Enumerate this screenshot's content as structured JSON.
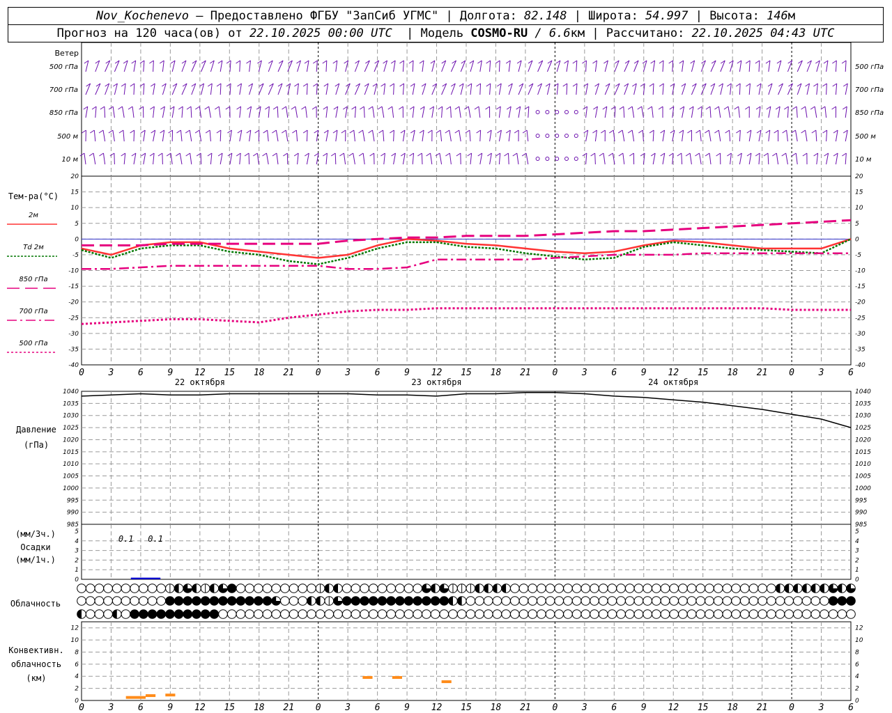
{
  "header": {
    "line1": {
      "station": "Nov_Kochenevo",
      "provider": " – Предоставлено ФГБУ \"ЗапСиб УГМС\" | Долгота: ",
      "lon": "82.148",
      "lat_label": " | Широта: ",
      "lat": "54.997",
      "alt_label": " | Высота: ",
      "alt": "146",
      "alt_unit": "м"
    },
    "line2": {
      "prefix": "Прогноз на 120 часа(ов) от ",
      "start": "22.10.2025 00:00 UTC",
      "model_label": "  | Модель ",
      "model": "COSMO-RU",
      "res": " / 6.6",
      "res_unit": "км",
      "calc_label": " | Рассчитано: ",
      "calc": "22.10.2025 04:43 UTC"
    }
  },
  "colors": {
    "wind": "#6a0dad",
    "t2m": "#ff3333",
    "td2m": "#007700",
    "t850": "#e6007e",
    "t700": "#e6007e",
    "t500": "#e6007e",
    "pressure": "#000000",
    "precip": "#0000cc",
    "convective": "#ff8c1a",
    "grid": "#9a9a9a"
  },
  "time_axis": {
    "hour_labels": [
      "0",
      "3",
      "6",
      "9",
      "12",
      "15",
      "18",
      "21",
      "0",
      "3",
      "6",
      "9",
      "12",
      "15",
      "18",
      "21",
      "0",
      "3",
      "6",
      "9",
      "12",
      "15",
      "18",
      "21",
      "0",
      "3",
      "6"
    ],
    "day_labels": [
      "22 октября",
      "23 октября",
      "24 октября"
    ]
  },
  "wind_panel": {
    "title": "Ветер",
    "levels": [
      "500 гПа",
      "700 гПа",
      "850 гПа",
      "500 м",
      "10 м"
    ]
  },
  "chart_data": [
    {
      "type": "line",
      "title": "Тем-ра(°C)",
      "ylim": [
        -40,
        20
      ],
      "yticks": [
        "20",
        "15",
        "10",
        "5",
        "0",
        "-5",
        "-10",
        "-15",
        "-20",
        "-25",
        "-30",
        "-35",
        "-40"
      ],
      "x_hours": [
        0,
        3,
        6,
        9,
        12,
        15,
        18,
        21,
        24,
        27,
        30,
        33,
        36,
        39,
        42,
        45,
        48,
        51,
        54,
        57,
        60,
        63,
        66,
        69,
        72,
        75,
        78
      ],
      "series": [
        {
          "name": "2м",
          "values": [
            -3,
            -5,
            -2,
            -1,
            -1,
            -3,
            -4,
            -5,
            -6,
            -5,
            -2,
            0,
            -0.5,
            -1.5,
            -2,
            -3,
            -4,
            -4.5,
            -4,
            -2,
            -0.5,
            -1,
            -2,
            -3,
            -3,
            -3,
            0
          ]
        },
        {
          "name": "Td 2м",
          "values": [
            -3.5,
            -6,
            -3,
            -2,
            -2,
            -4,
            -5,
            -7,
            -8,
            -6,
            -3,
            -1,
            -1,
            -2.5,
            -3,
            -4.5,
            -5.5,
            -6.5,
            -6,
            -2.5,
            -1,
            -2,
            -3,
            -3.5,
            -4,
            -4.5,
            0
          ]
        },
        {
          "name": "850 гПа",
          "values": [
            -2,
            -2,
            -2,
            -1.5,
            -1.5,
            -1.5,
            -1.5,
            -1.5,
            -1.5,
            -0.5,
            0,
            0.5,
            0.5,
            1,
            1,
            1,
            1.5,
            2,
            2.5,
            2.5,
            3,
            3.5,
            4,
            4.5,
            5,
            5.5,
            6
          ]
        },
        {
          "name": "700 гПа",
          "values": [
            -9.5,
            -9.5,
            -9,
            -8.5,
            -8.5,
            -8.5,
            -8.5,
            -8.5,
            -8.5,
            -9.5,
            -9.5,
            -9,
            -6.5,
            -6.5,
            -6.5,
            -6.5,
            -6,
            -5.5,
            -5,
            -5,
            -5,
            -4.5,
            -4.5,
            -4.5,
            -4.5,
            -4.5,
            -4.5
          ]
        },
        {
          "name": "500 гПа",
          "values": [
            -27,
            -26.5,
            -26,
            -25.5,
            -25.5,
            -26,
            -26.5,
            -25,
            -24,
            -23,
            -22.5,
            -22.5,
            -22,
            -22,
            -22,
            -22,
            -22,
            -22,
            -22,
            -22,
            -22,
            -22,
            -22,
            -22,
            -22.5,
            -22.5,
            -22.5
          ]
        }
      ]
    },
    {
      "type": "line",
      "title": "Давление",
      "ylabel": "(гПа)",
      "ylim": [
        985,
        1040
      ],
      "yticks": [
        "1040",
        "1035",
        "1030",
        "1025",
        "1020",
        "1015",
        "1010",
        "1005",
        "1000",
        "995",
        "990",
        "985"
      ],
      "x_hours": [
        0,
        3,
        6,
        9,
        12,
        15,
        18,
        21,
        24,
        27,
        30,
        33,
        36,
        39,
        42,
        45,
        48,
        51,
        54,
        57,
        60,
        63,
        66,
        69,
        72,
        75,
        78
      ],
      "series": [
        {
          "name": "Давление",
          "values": [
            1038,
            1038.5,
            1039,
            1038.5,
            1038.5,
            1039,
            1039,
            1039,
            1039,
            1039,
            1038.5,
            1038.5,
            1038,
            1039,
            1039,
            1039.5,
            1039.5,
            1039,
            1038,
            1037.5,
            1036.5,
            1035.5,
            1034,
            1032.5,
            1030.5,
            1028.5,
            1025
          ]
        }
      ]
    },
    {
      "type": "bar",
      "title": "Осадки",
      "ylabel_top": "(мм/3ч.)",
      "ylabel_bottom": "(мм/1ч.)",
      "ylim": [
        0,
        5
      ],
      "yticks": [
        "5",
        "4",
        "3",
        "2",
        "1",
        "0"
      ],
      "annotations": [
        {
          "hour": 4.5,
          "text": "0.1"
        },
        {
          "hour": 7.5,
          "text": "0.1"
        }
      ],
      "bars": [
        {
          "from": 5,
          "to": 8,
          "value": 0.1
        }
      ]
    },
    {
      "type": "bar",
      "title": "Конвективн.",
      "ylabel_mid": "облачность",
      "ylabel": "(км)",
      "ylim": [
        0,
        13
      ],
      "yticks": [
        "12",
        "10",
        "8",
        "6",
        "4",
        "2",
        "0"
      ],
      "segments": [
        {
          "from": 4.5,
          "to": 6.5,
          "value": 0.5
        },
        {
          "from": 6.5,
          "to": 7.5,
          "value": 0.8
        },
        {
          "from": 8.5,
          "to": 9.5,
          "value": 0.9
        },
        {
          "from": 28.5,
          "to": 29.5,
          "value": 3.8
        },
        {
          "from": 31.5,
          "to": 32.5,
          "value": 3.8
        },
        {
          "from": 36.5,
          "to": 37.5,
          "value": 3.1
        }
      ]
    }
  ],
  "cloud_panel": {
    "title": "Облачность",
    "rows": [
      "0000000000123212340000000001220000000003231112222000000000000000000000000000000222222323",
      "0000000000444444444444300022134444444444442200000000000000000000000000000000000000000444",
      "2000204444444444000000000000000000000000000000000000000000000000000000000000000000000000"
    ]
  }
}
